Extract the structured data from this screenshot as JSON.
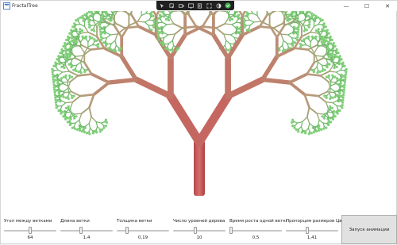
{
  "window": {
    "title": "FractalTree",
    "minimize_glyph": "—",
    "maximize_glyph": "☐",
    "close_glyph": "✕"
  },
  "toolbar_icons": [
    "cursor-icon",
    "select-element-icon",
    "video-icon",
    "display-layout-icon",
    "adorner-icon",
    "track-focus-icon",
    "contrast-icon",
    "check-icon"
  ],
  "controls": [
    {
      "label": "Угол между ветками",
      "value": "64",
      "level": 0.5
    },
    {
      "label": "Длина ветки",
      "value": "1,4",
      "level": 0.38
    },
    {
      "label": "Толщина ветки",
      "value": "0,19",
      "level": 0.18
    },
    {
      "label": "Число уровней дерева",
      "value": "10",
      "level": 0.42
    },
    {
      "label": "Время роста одной ветки",
      "value": "0,5",
      "level": 0.0
    },
    {
      "label": "Пропорция размеров Цв",
      "value": "1,41",
      "level": 0.4
    }
  ],
  "anim_button": {
    "label": "Запуск анимации"
  },
  "colors": {
    "trunk": "#c85a5a",
    "branch_mid": "#b89a7a",
    "leaves": "#6fb86a"
  }
}
